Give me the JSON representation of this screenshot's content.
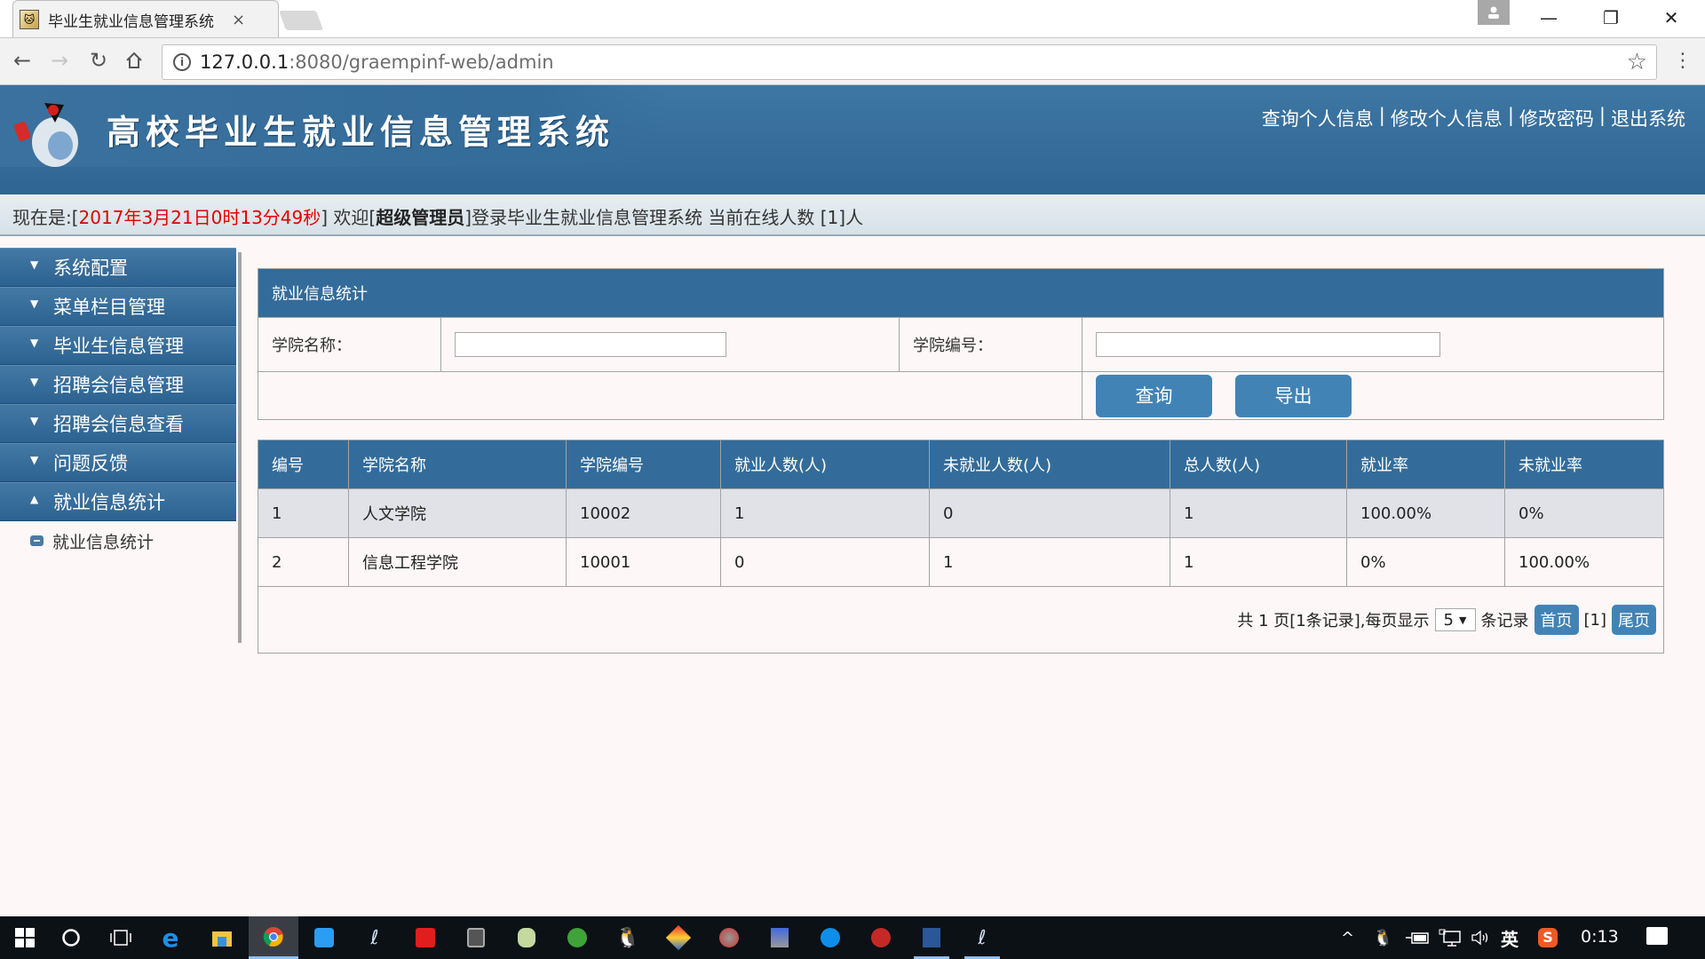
{
  "browser": {
    "tab_title": "毕业生就业信息管理系统",
    "tab_close": "×",
    "url_host": "127.0.0.1",
    "url_rest": ":8080/graempinf-web/admin",
    "icons": {
      "back": "←",
      "forward": "→",
      "reload": "↻",
      "home": "⌂",
      "info": "i",
      "star": "☆",
      "menu": "⋮",
      "minimize": "—",
      "restore": "❐",
      "close": "✕",
      "profile": "👤"
    }
  },
  "header": {
    "site_title": "高校毕业生就业信息管理系统",
    "links": [
      "查询个人信息",
      "修改个人信息",
      "修改密码",
      "退出系统"
    ],
    "separator": "|"
  },
  "status": {
    "prefix": "现在是:[",
    "datetime": "2017年3月21日0时13分49秒",
    "mid1": "] 欢迎[",
    "role": "超级管理员",
    "mid2": "]登录毕业生就业信息管理系统 当前在线人数 [1]人"
  },
  "sidebar": {
    "items": [
      {
        "label": "系统配置",
        "arrow": "▼"
      },
      {
        "label": "菜单栏目管理",
        "arrow": "▼"
      },
      {
        "label": "毕业生信息管理",
        "arrow": "▼"
      },
      {
        "label": "招聘会信息管理",
        "arrow": "▼"
      },
      {
        "label": "招聘会信息查看",
        "arrow": "▼"
      },
      {
        "label": "问题反馈",
        "arrow": "▼"
      },
      {
        "label": "就业信息统计",
        "arrow": "▲"
      }
    ],
    "sub_items": [
      {
        "label": "就业信息统计"
      }
    ]
  },
  "search_form": {
    "title": "就业信息统计",
    "college_name_label": "学院名称：",
    "college_name_value": "",
    "college_code_label": "学院编号：",
    "college_code_value": "",
    "query_button": "查询",
    "export_button": "导出"
  },
  "table": {
    "columns": [
      "编号",
      "学院名称",
      "学院编号",
      "就业人数(人)",
      "未就业人数(人)",
      "总人数(人)",
      "就业率",
      "未就业率"
    ],
    "rows": [
      [
        "1",
        "人文学院",
        "10002",
        "1",
        "0",
        "1",
        "100.00%",
        "0%"
      ],
      [
        "2",
        "信息工程学院",
        "10001",
        "0",
        "1",
        "1",
        "0%",
        "100.00%"
      ]
    ]
  },
  "pager": {
    "summary": "共 1 页[1条记录],每页显示",
    "page_size": "5",
    "caret": "▼",
    "records_label": "条记录",
    "first_button": "首页",
    "current_page": "[1]",
    "last_button": "尾页"
  },
  "taskbar": {
    "apps": [
      "windows-start",
      "cortana",
      "task-view",
      "edge",
      "file-explorer",
      "chrome",
      "baidu-input",
      "eclipse",
      "netease-music",
      "sublime",
      "database-tool",
      "green-app",
      "qq",
      "app-colorful",
      "app-disc",
      "network-tool",
      "teamviewer",
      "app-red",
      "word",
      "eclipse-2"
    ],
    "tray": {
      "chevron": "^",
      "ime": "英",
      "clock": "0:13"
    }
  },
  "colors": {
    "header_blue": "#336c9a",
    "button_blue": "#4283b6",
    "status_red": "#e40000",
    "page_bg": "#fdf7f7",
    "row_alt": "#e1e1e8"
  }
}
